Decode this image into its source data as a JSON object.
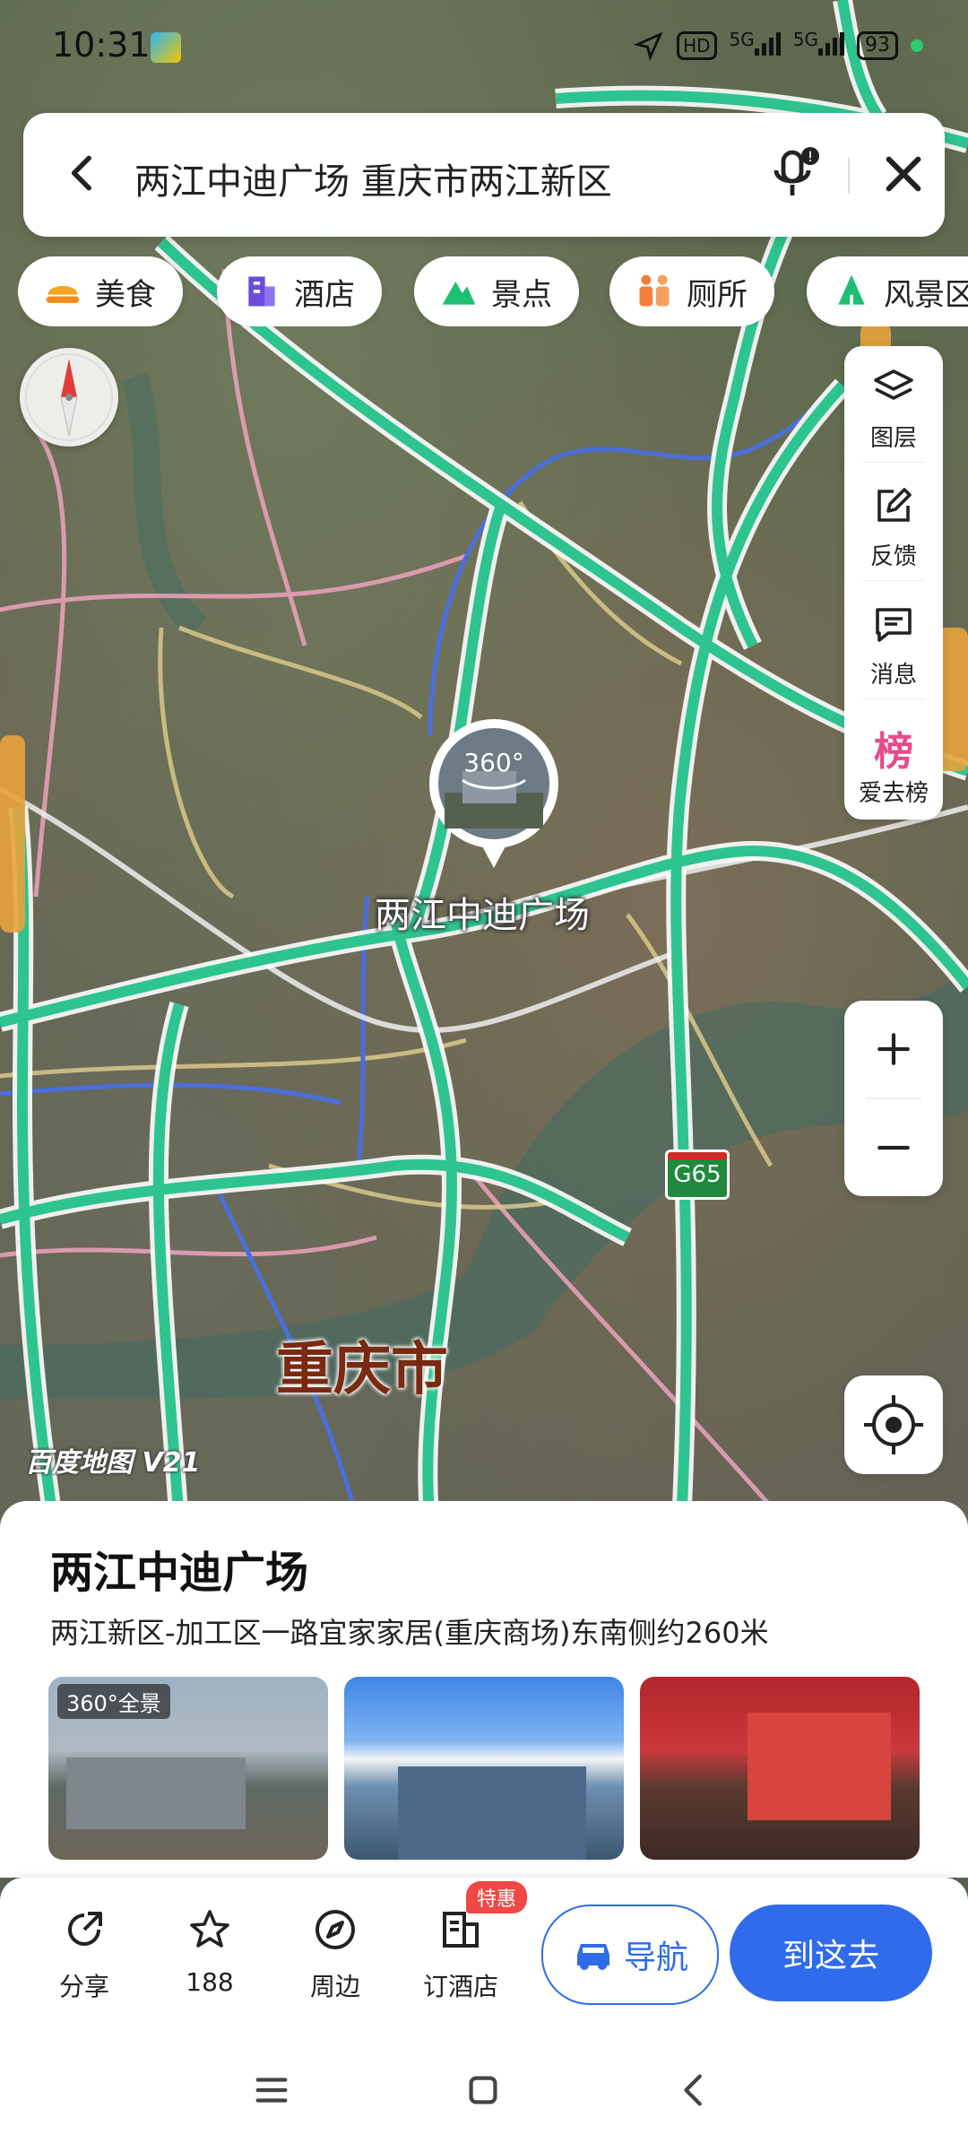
{
  "status_bar": {
    "time": "10:31",
    "hd_label": "HD",
    "signal1": "5G",
    "signal2": "5G",
    "battery": "93"
  },
  "search": {
    "query": "两江中迪广场 重庆市两江新区"
  },
  "categories": [
    {
      "label": "美食",
      "icon": "food-icon",
      "color": "#f5a623"
    },
    {
      "label": "酒店",
      "icon": "hotel-icon",
      "color": "#6a4cdb"
    },
    {
      "label": "景点",
      "icon": "scenic-icon",
      "color": "#1dbf73"
    },
    {
      "label": "厕所",
      "icon": "toilet-icon",
      "color": "#f27f3b"
    },
    {
      "label": "风景区",
      "icon": "scenic-area-icon",
      "color": "#1dbf73"
    }
  ],
  "tools": {
    "layers": "图层",
    "feedback": "反馈",
    "messages": "消息",
    "ranking_icon_text": "榜",
    "ranking": "爱去榜"
  },
  "map": {
    "poi_label": "两江中迪广场",
    "pin_text": "360°",
    "city_label": "重庆市",
    "highway_shield": "G65",
    "brand": "百度地图 V21",
    "road_color": "#2ec48f"
  },
  "place": {
    "name": "两江中迪广场",
    "address": "两江新区-加工区一路宜家家居(重庆商场)东南侧约260米",
    "photo_tag": "360°全景"
  },
  "actions": {
    "share": "分享",
    "favorites": "188",
    "nearby": "周边",
    "hotel": "订酒店",
    "hotel_badge": "特惠",
    "navigate": "导航",
    "go_here": "到这去"
  },
  "colors": {
    "accent": "#2f6bea",
    "badge": "#f04747"
  }
}
